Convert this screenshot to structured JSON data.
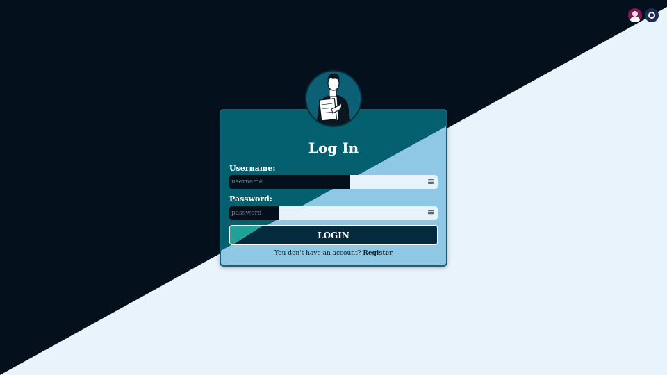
{
  "page": {
    "colors": {
      "dark_background": "#04111c",
      "light_background": "#e8f3fb",
      "card_teal": "#04606f",
      "card_light_blue": "#8fc8e5",
      "button_dark": "#042a40",
      "button_accent": "#22a19a"
    }
  },
  "header_icons": [
    {
      "name": "user-avatar-icon"
    },
    {
      "name": "ring-icon"
    }
  ],
  "login": {
    "title": "Log In",
    "username_label": "Username:",
    "username_placeholder": "username",
    "password_label": "Password:",
    "password_placeholder": "password",
    "button_label": "LOGIN",
    "register_prompt": "You don't have an account?",
    "register_link": "Register"
  }
}
